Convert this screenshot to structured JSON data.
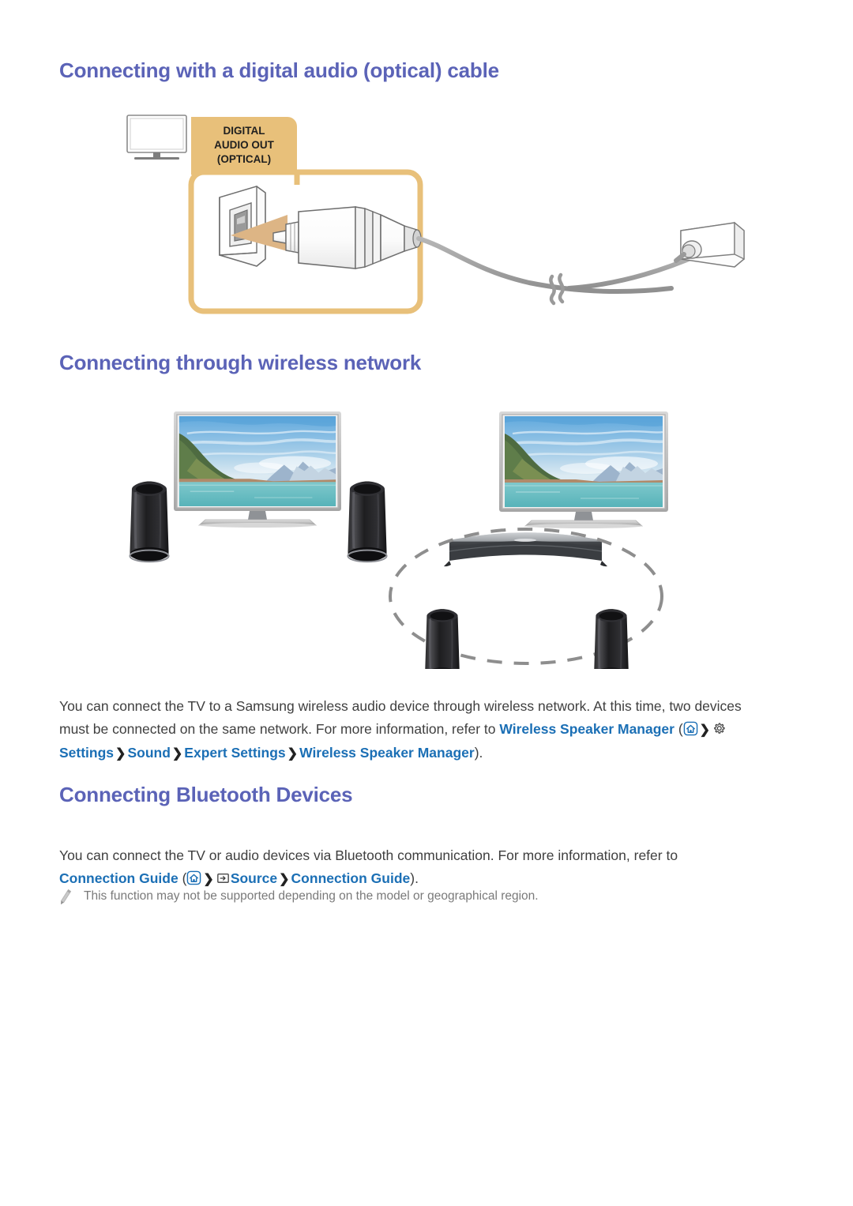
{
  "page": {
    "background": "#ffffff",
    "heading_color": "#5b63b7",
    "link_color": "#1b6fb5",
    "body_color": "#3f3f3f",
    "note_color": "#7a7a7a",
    "accent_amber": "#e8c07a"
  },
  "sections": {
    "optical": {
      "title": "Connecting with a digital audio (optical) cable",
      "port_label_line1": "DIGITAL",
      "port_label_line2": "AUDIO OUT",
      "port_label_line3": "(OPTICAL)",
      "tv_icon_name": "tv-icon",
      "port_icon_name": "optical-port-icon",
      "plug_icon_name": "optical-plug-icon",
      "arrow_icon_name": "insert-arrow-icon",
      "cable_break_icon_name": "cable-break-icon",
      "wallplate_icon_name": "wall-plate-jack-icon"
    },
    "wireless": {
      "title": "Connecting through wireless network",
      "paragraph": {
        "t1": "You can connect the TV to a Samsung wireless audio device through wireless network. At this time, two devices must be connected on the same network. For more information, refer to ",
        "link1": "Wireless Speaker Manager",
        "open_paren": " (",
        "home_icon": "home-icon",
        "chevron": "❯",
        "gear_icon": "gear-icon",
        "crumb1": "Settings",
        "crumb2": "Sound",
        "crumb3": "Expert Settings",
        "crumb4": "Wireless Speaker Manager",
        "close_paren": ")."
      },
      "diagram": {
        "left_group_name": "flat-tv-with-two-speakers",
        "right_group_name": "curved-tv-with-soundbar-and-surround-speakers",
        "surround_zone_name": "surround-zone-dashed-ellipse"
      }
    },
    "bluetooth": {
      "title": "Connecting Bluetooth Devices",
      "paragraph": {
        "t1": "You can connect the TV or audio devices via Bluetooth communication. For more information, refer to ",
        "link1": "Connection Guide",
        "open_paren": " (",
        "home_icon": "home-icon",
        "chevron": "❯",
        "source_icon": "source-icon",
        "crumb1": "Source",
        "crumb2": "Connection Guide",
        "close_paren": ")."
      },
      "note": {
        "icon": "pencil-note-icon",
        "text": "This function may not be supported depending on the model or geographical region."
      }
    }
  }
}
